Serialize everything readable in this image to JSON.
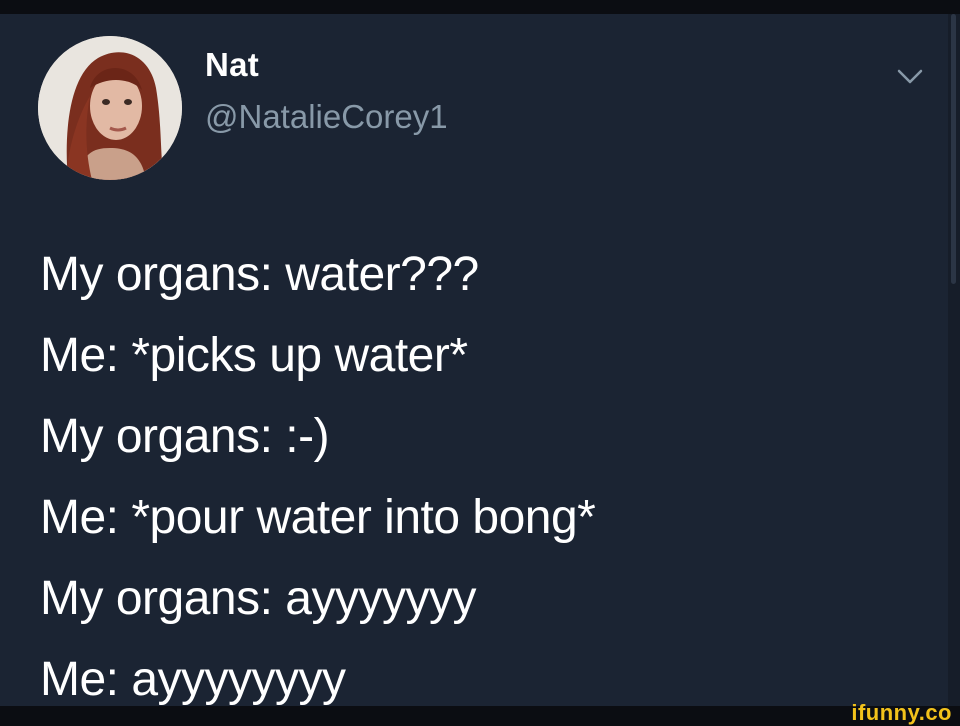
{
  "tweet": {
    "author": {
      "display_name": "Nat",
      "handle": "@NatalieCorey1"
    },
    "lines": [
      "My organs: water???",
      "Me: *picks up water*",
      "My organs: :-)",
      "Me: *pour water into bong*",
      "My organs: ayyyyyyy",
      "Me: ayyyyyyyy"
    ]
  },
  "icons": {
    "menu": "chevron-down-icon"
  },
  "watermark": {
    "text": "ifunny.co"
  },
  "colors": {
    "background": "#1b2433",
    "text": "#ffffff",
    "handle": "#8899a8",
    "watermark": "#f2c21b"
  }
}
